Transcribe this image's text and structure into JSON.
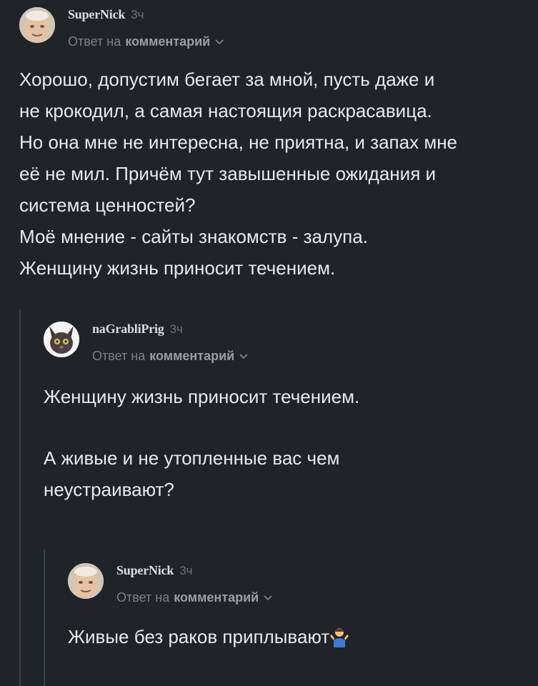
{
  "comments": [
    {
      "author": "SuperNick",
      "time": "3ч",
      "reply_prefix": "Ответ на",
      "reply_target": "комментарий",
      "paragraphs": [
        "Хорошо, допустим бегает за мной, пусть даже и",
        "не крокодил, а самая настоящия раскрасавица.",
        "Но она мне не интересна, не приятна, и запах мне",
        "её не мил. Причём тут завышенные ожидания и",
        "система ценностей?",
        "Моё мнение - сайты знакомств - залупа.",
        "Женщину жизнь приносит течением."
      ]
    },
    {
      "author": "naGrabliPrig",
      "time": "3ч",
      "reply_prefix": "Ответ на",
      "reply_target": "комментарий",
      "paragraphs": [
        "Женщину жизнь приносит течением.",
        "А живые и не утопленные вас чем",
        "неустраивают?"
      ]
    },
    {
      "author": "SuperNick",
      "time": "3ч",
      "reply_prefix": "Ответ на",
      "reply_target": "комментарий",
      "paragraphs": [
        "Живые без раков приплывают"
      ],
      "emoji": "person-shrugging-emoji"
    }
  ],
  "colors": {
    "background": "#202327",
    "text": "#e8e9eb",
    "muted": "#80848a",
    "thread_line": "#3a3e44"
  }
}
